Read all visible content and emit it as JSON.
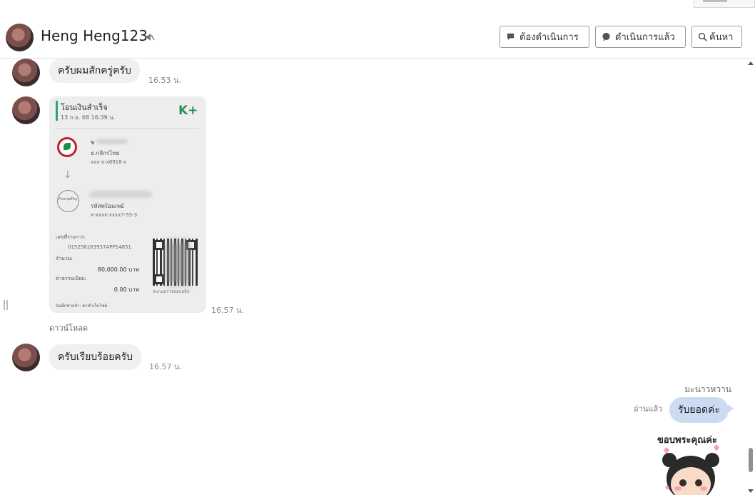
{
  "header": {
    "contact_name": "Heng Heng123",
    "btn_todo": "ต้องดำเนินการ",
    "btn_done": "ดำเนินการแล้ว",
    "btn_search": "ค้นหา"
  },
  "messages": {
    "m1_text": "ครับผมสักครู่ครับ",
    "m1_time": "16.53 น.",
    "m2_time": "16.57 น.",
    "download": "ดาวน์โหลด",
    "m3_text": "ครับเรียบร้อยครับ",
    "m3_time": "16.57 น."
  },
  "slip": {
    "title": "โอนเงินสำเร็จ",
    "date": "13 ก.ย. 68  16:39 น.",
    "brand": "K+",
    "from_initial": "ข",
    "from_bank": "ธ.กสิกรไทย",
    "from_account": "xxx-x-x8918-x",
    "to_label": "รหัสพร้อมเพย์",
    "to_account": "x-xxxx-xxxx7-55-3",
    "ref_label": "เลขที่รายการ:",
    "ref_number": "015256163937APP14851",
    "amount_label": "จำนวน:",
    "amount": "80,000.00 บาท",
    "fee_label": "ค่าธรรมเนียม:",
    "fee": "0.00 บาท",
    "footer": "บันทึกช่วยจำ: ค่าทำเว็บไซต์",
    "qr_caption": "สแกนตรวจสอบสลิป"
  },
  "outgoing": {
    "sender": "มะนาวหวาน",
    "read": "อ่านแล้ว",
    "text": "รับยอดค่ะ"
  },
  "sticker": {
    "text": "ขอบพระคุณค่ะ"
  }
}
